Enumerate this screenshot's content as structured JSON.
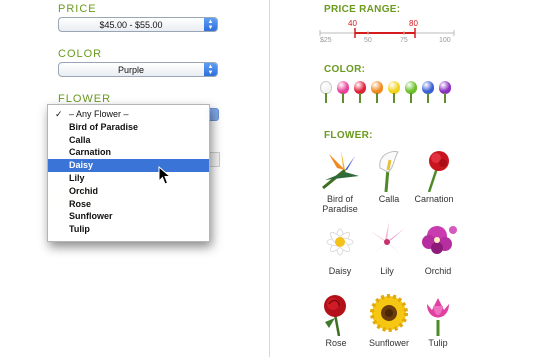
{
  "left": {
    "price_label": "PRICE",
    "price_value": "$45.00 - $55.00",
    "color_label": "COLOR",
    "color_value": "Purple",
    "flower_label": "FLOWER",
    "flower_menu": [
      {
        "label": "– Any Flower –",
        "checked": true
      },
      {
        "label": "Bird of Paradise"
      },
      {
        "label": "Calla"
      },
      {
        "label": "Carnation"
      },
      {
        "label": "Daisy",
        "selected": true
      },
      {
        "label": "Lily"
      },
      {
        "label": "Orchid"
      },
      {
        "label": "Rose"
      },
      {
        "label": "Sunflower"
      },
      {
        "label": "Tulip"
      }
    ],
    "check_mark": "✓"
  },
  "right": {
    "price_range_label": "PRICE RANGE:",
    "price_low": "40",
    "price_high": "80",
    "scale_ticks": [
      "$25",
      "50",
      "75",
      "100"
    ],
    "color_label": "COLOR:",
    "colors": [
      "#f4f4f4",
      "#e8429a",
      "#e0213a",
      "#f08a1e",
      "#f2d21a",
      "#6cc12a",
      "#3b5fd6",
      "#8a2fc0"
    ],
    "flower_label": "FLOWER:",
    "flowers": [
      {
        "name": "Bird of Paradise",
        "icon": "bird-of-paradise-icon"
      },
      {
        "name": "Calla",
        "icon": "calla-icon"
      },
      {
        "name": "Carnation",
        "icon": "carnation-icon"
      },
      {
        "name": "Daisy",
        "icon": "daisy-icon"
      },
      {
        "name": "Lily",
        "icon": "lily-icon"
      },
      {
        "name": "Orchid",
        "icon": "orchid-icon"
      },
      {
        "name": "Rose",
        "icon": "rose-icon"
      },
      {
        "name": "Sunflower",
        "icon": "sunflower-icon"
      },
      {
        "name": "Tulip",
        "icon": "tulip-icon"
      }
    ]
  }
}
